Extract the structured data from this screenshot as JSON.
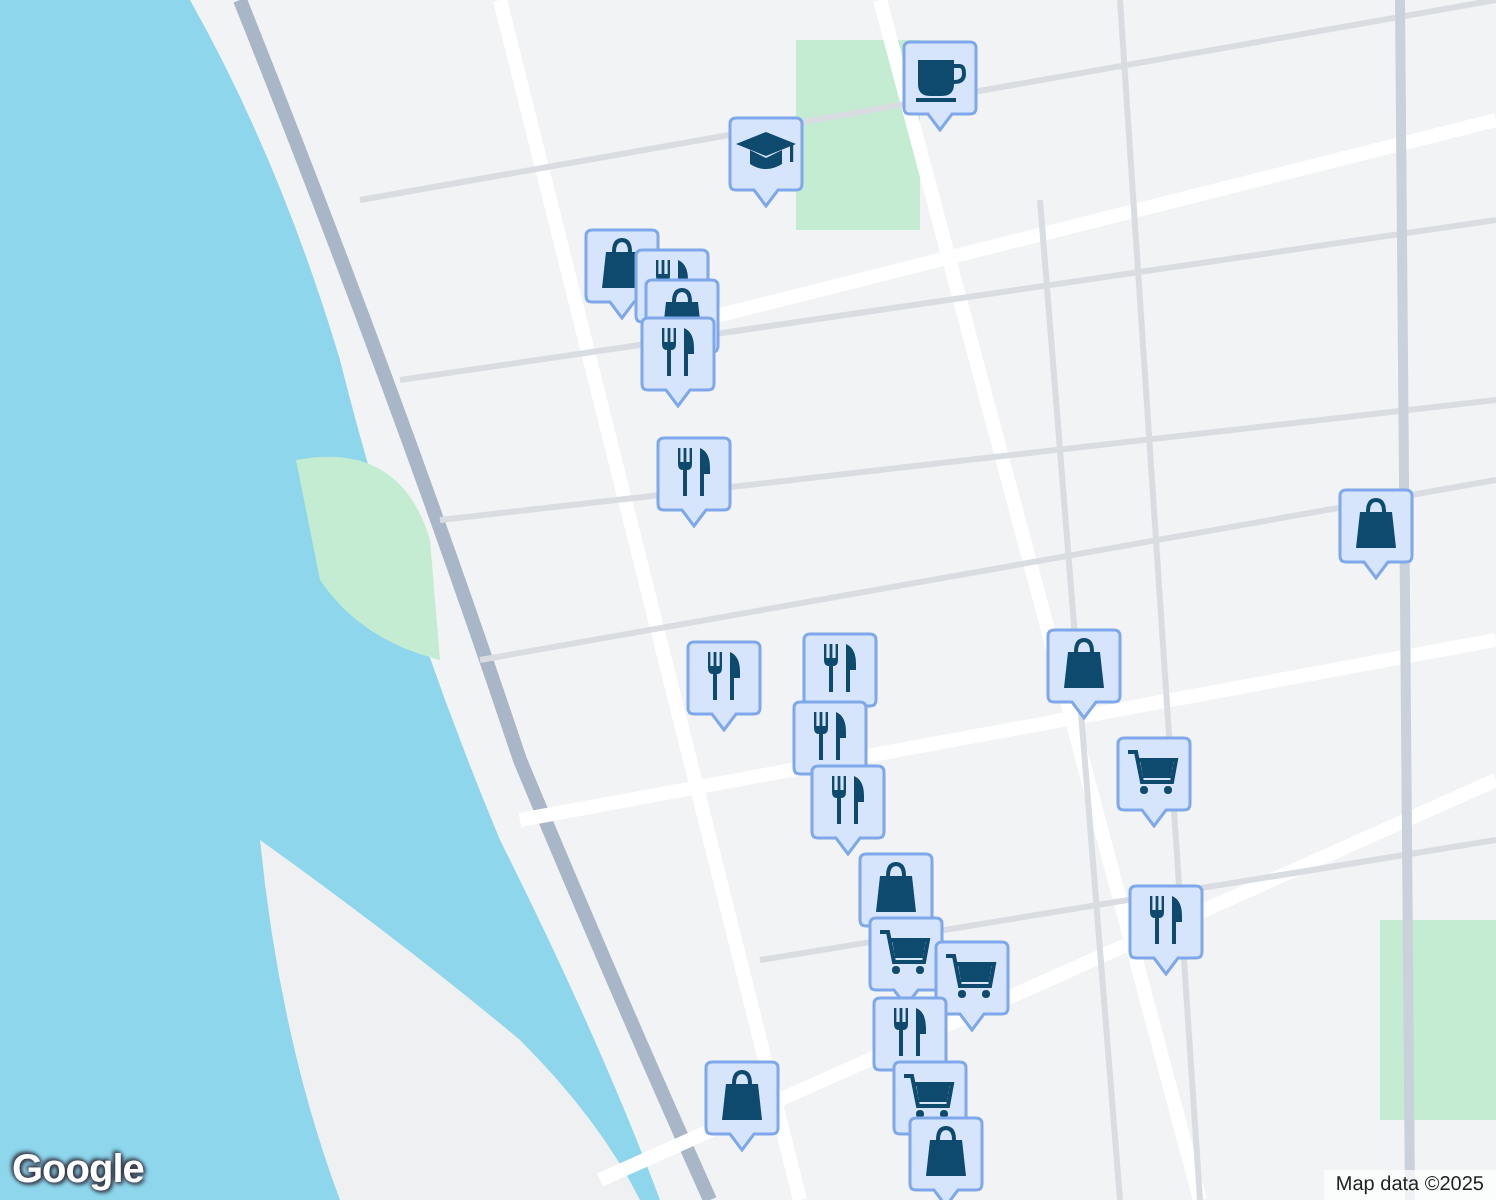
{
  "markers": [
    {
      "kind": "coffee"
    },
    {
      "kind": "school"
    },
    {
      "kind": "bag"
    },
    {
      "kind": "food"
    },
    {
      "kind": "bag"
    },
    {
      "kind": "food"
    },
    {
      "kind": "food"
    },
    {
      "kind": "bag"
    },
    {
      "kind": "food"
    },
    {
      "kind": "food"
    },
    {
      "kind": "bag"
    },
    {
      "kind": "food"
    },
    {
      "kind": "cart"
    },
    {
      "kind": "food"
    },
    {
      "kind": "bag"
    },
    {
      "kind": "food"
    },
    {
      "kind": "cart"
    },
    {
      "kind": "cart"
    },
    {
      "kind": "food"
    },
    {
      "kind": "bag"
    },
    {
      "kind": "cart"
    },
    {
      "kind": "bag"
    }
  ],
  "logo": "Google",
  "attribution": "Map data ©2025"
}
